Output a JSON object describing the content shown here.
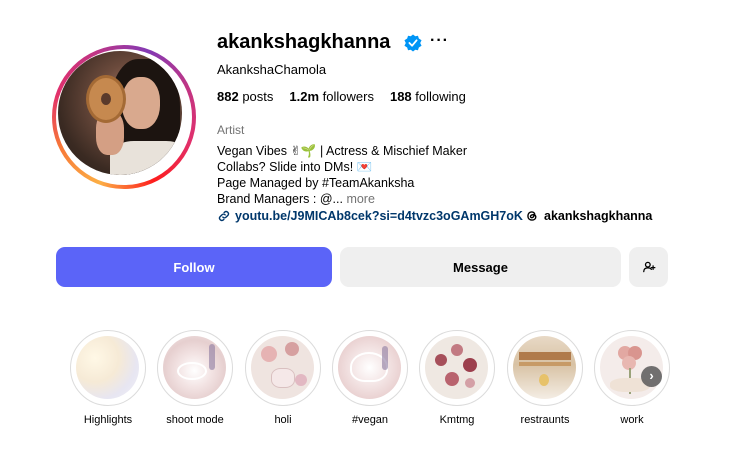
{
  "profile": {
    "username": "akankshagkhanna",
    "full_name": "AkankshaChamola",
    "stats": {
      "posts": "882",
      "posts_label": "posts",
      "followers": "1.2m",
      "followers_label": "followers",
      "following": "188",
      "following_label": "following"
    },
    "category": "Artist",
    "bio_lines": [
      "Vegan Vibes ✌🌱 | Actress & Mischief Maker",
      "Collabs? Slide into DMs! 💌",
      "Page Managed by #TeamAkanksha",
      "Brand Managers : @..."
    ],
    "bio_more": "more",
    "link": "youtu.be/J9MICAb8cek?si=d4tvzc3oGAmGH7oK",
    "threads_handle": "akankshagkhanna"
  },
  "actions": {
    "follow_label": "Follow",
    "message_label": "Message"
  },
  "highlights": [
    {
      "label": "Highlights"
    },
    {
      "label": "shoot mode"
    },
    {
      "label": "holi"
    },
    {
      "label": "#vegan"
    },
    {
      "label": "Kmtmg"
    },
    {
      "label": "restraunts"
    },
    {
      "label": "work"
    }
  ],
  "colors": {
    "follow_button": "#5b64f8",
    "link": "#00376b",
    "verified": "#0095f6"
  },
  "icons": {
    "verified": "verified-badge-icon",
    "more": "more-options-icon",
    "link": "link-icon",
    "threads": "threads-icon",
    "add_person": "add-person-icon",
    "next": "chevron-right-icon"
  }
}
